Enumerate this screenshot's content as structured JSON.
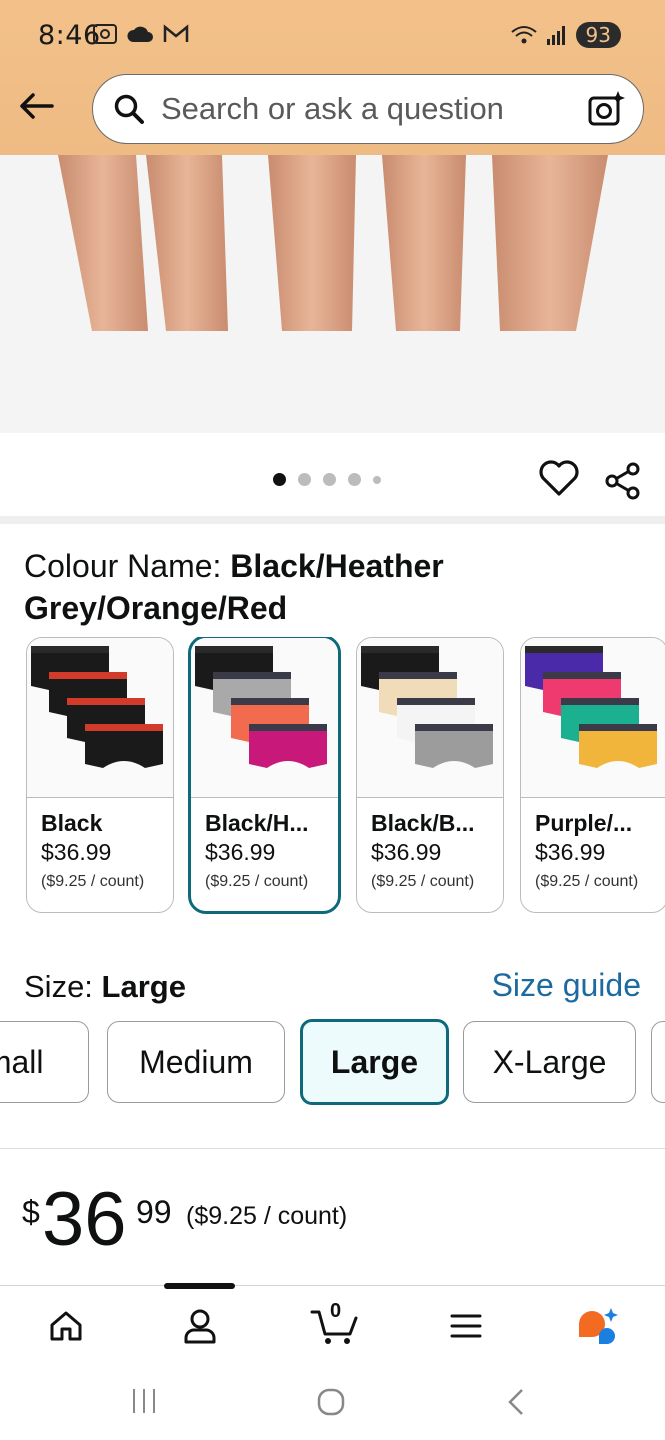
{
  "status_bar": {
    "time": "8:46",
    "battery": "93"
  },
  "search": {
    "placeholder": "Search or ask a question"
  },
  "gallery": {
    "dot_count": 5,
    "active_index": 0
  },
  "colour": {
    "label": "Colour Name: ",
    "value": "Black/Heather Grey/Orange/Red",
    "options": [
      {
        "name": "Black",
        "price": "$36.99",
        "unit": "($9.25 / count)",
        "colors": [
          "#1a1a1a",
          "#1a1a1a",
          "#1a1a1a",
          "#1a1a1a"
        ]
      },
      {
        "name": "Black/H...",
        "price": "$36.99",
        "unit": "($9.25 / count)",
        "colors": [
          "#1a1a1a",
          "#a9a9a9",
          "#f26b4f",
          "#c8187a"
        ]
      },
      {
        "name": "Black/B...",
        "price": "$36.99",
        "unit": "($9.25 / count)",
        "colors": [
          "#1a1a1a",
          "#f0dcb8",
          "#f4f4f4",
          "#9c9c9c"
        ]
      },
      {
        "name": "Purple/...",
        "price": "$36.99",
        "unit": "($9.25 / count)",
        "colors": [
          "#4a2aa8",
          "#ee3a6e",
          "#1bb190",
          "#f0b53a"
        ]
      }
    ],
    "selected_index": 1
  },
  "size": {
    "label": "Size: ",
    "value": "Large",
    "guide_label": "Size guide",
    "options": [
      "Small",
      "Medium",
      "Large",
      "X-Large",
      ""
    ],
    "selected_index": 2
  },
  "price": {
    "symbol": "$",
    "whole": "36",
    "fraction": "99",
    "unit": "($9.25 / count)"
  },
  "bottom_nav": {
    "cart_count": "0",
    "active_index": 1
  },
  "colors": {
    "header_bg": "#f2c189",
    "accent_teal": "#0e6a7a",
    "link_blue": "#1d6aa0",
    "rufus_orange": "#f26b21",
    "rufus_blue": "#1a7fe0"
  }
}
